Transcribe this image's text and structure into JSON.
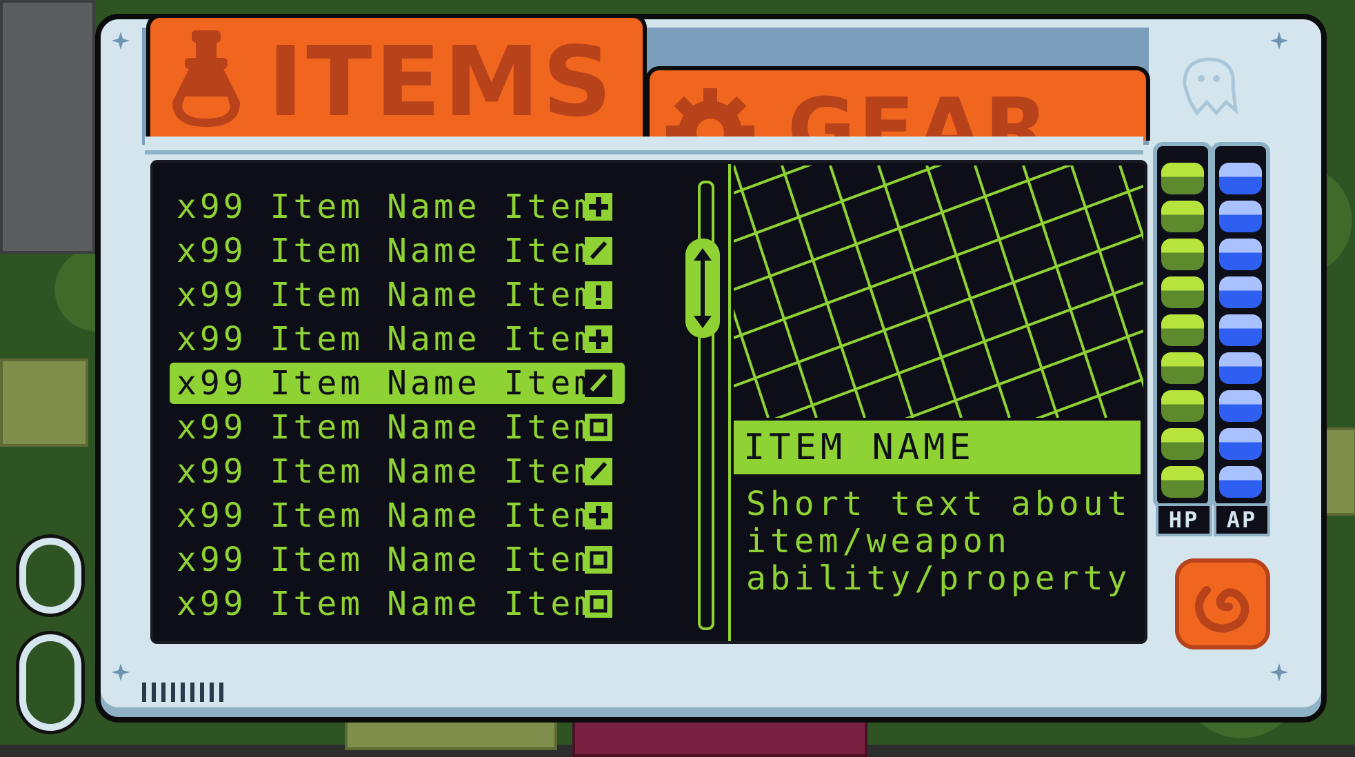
{
  "tabs": [
    {
      "label": "ITEMS",
      "icon": "potion-icon",
      "active": true
    },
    {
      "label": "GEAR",
      "icon": "gear-icon",
      "active": false
    }
  ],
  "inventory": {
    "items": [
      {
        "quantity": "x99",
        "name": "Item Name Item",
        "icon": "plus-icon",
        "selected": false
      },
      {
        "quantity": "x99",
        "name": "Item Name Item",
        "icon": "slash-icon",
        "selected": false
      },
      {
        "quantity": "x99",
        "name": "Item Name Item",
        "icon": "exclamation-icon",
        "selected": false
      },
      {
        "quantity": "x99",
        "name": "Item Name Item",
        "icon": "plus-icon",
        "selected": false
      },
      {
        "quantity": "x99",
        "name": "Item Name Item",
        "icon": "slash-icon",
        "selected": true
      },
      {
        "quantity": "x99",
        "name": "Item Name Item",
        "icon": "square-icon",
        "selected": false
      },
      {
        "quantity": "x99",
        "name": "Item Name Item",
        "icon": "slash-icon",
        "selected": false
      },
      {
        "quantity": "x99",
        "name": "Item Name Item",
        "icon": "plus-icon",
        "selected": false
      },
      {
        "quantity": "x99",
        "name": "Item Name Item",
        "icon": "square-icon",
        "selected": false
      },
      {
        "quantity": "x99",
        "name": "Item Name Item",
        "icon": "square-icon",
        "selected": false
      }
    ]
  },
  "detail": {
    "title": "ITEM NAME",
    "description_lines": [
      "Short text about",
      "item/weapon",
      "ability/property"
    ]
  },
  "stats": {
    "hp": {
      "label": "HP",
      "cells": 9,
      "filled": 9
    },
    "ap": {
      "label": "AP",
      "cells": 9,
      "filled": 9
    }
  },
  "colors": {
    "accent_green": "#8fd234",
    "accent_orange": "#f0661f",
    "screen_dark": "#0e0e18",
    "frame_light": "#d4e5ee",
    "ap_blue": "#2f5ff0"
  }
}
